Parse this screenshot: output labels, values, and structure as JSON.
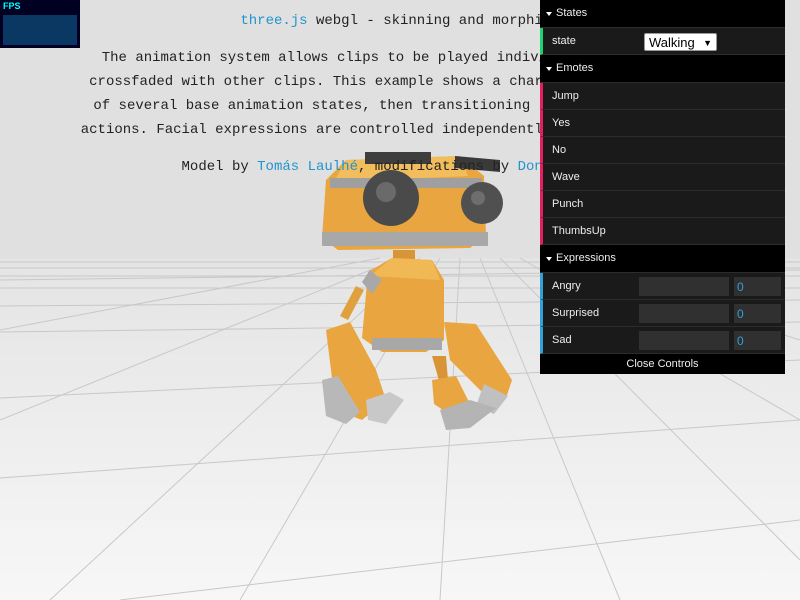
{
  "page_title_link": "three.js",
  "page_title_rest": " webgl - skinning and morphing",
  "description_lines": [
    "The animation system allows clips to be played individually, looped, or",
    "crossfaded with other clips. This example shows a character looping in one",
    "of several base animation states, then transitioning smoothly to one-time",
    "actions. Facial expressions are controlled independently with morph targets."
  ],
  "credit": {
    "prefix": "Model by ",
    "author": "Tomás Laulhé",
    "middle": ", modifications by ",
    "modifier": "Don McCurdy",
    "suffix": "."
  },
  "fps": {
    "label": "FPS"
  },
  "gui": {
    "states_folder": "States",
    "state_label": "state",
    "state_value": "Walking",
    "emotes_folder": "Emotes",
    "emotes": [
      "Jump",
      "Yes",
      "No",
      "Wave",
      "Punch",
      "ThumbsUp"
    ],
    "expressions_folder": "Expressions",
    "expressions": [
      {
        "label": "Angry",
        "value": "0"
      },
      {
        "label": "Surprised",
        "value": "0"
      },
      {
        "label": "Sad",
        "value": "0"
      }
    ],
    "close_label": "Close Controls"
  },
  "colors": {
    "background": "#e0e0e0",
    "link": "#2194ce",
    "robot_body": "#e9a53f",
    "robot_metal": "#a8a8a8",
    "state_accent": "#1ed36f",
    "function_accent": "#e61d5f",
    "number_accent": "#2fa1d6"
  }
}
